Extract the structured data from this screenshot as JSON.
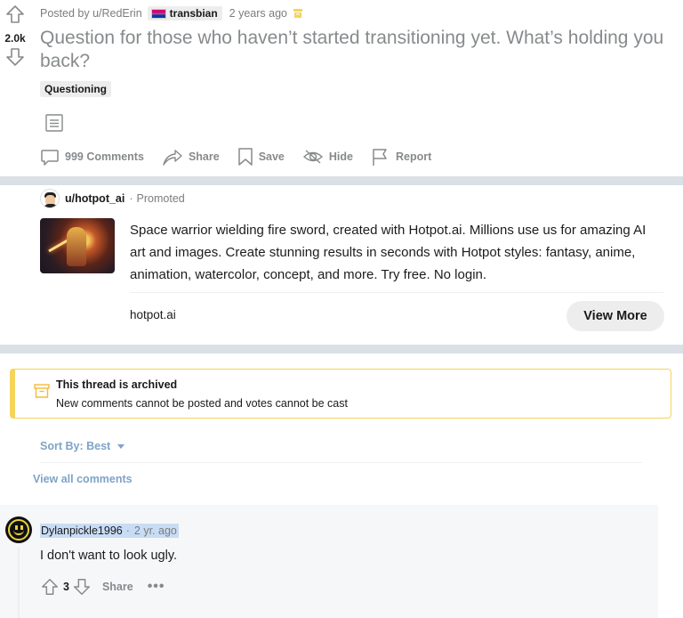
{
  "post": {
    "vote_score": "2.0k",
    "posted_by": "Posted by u/RedErin",
    "user_flair": "transbian",
    "time": "2 years ago",
    "title": "Question for those who haven’t started transitioning yet. What’s holding you back?",
    "flair": "Questioning",
    "actions": {
      "comments": "999 Comments",
      "share": "Share",
      "save": "Save",
      "hide": "Hide",
      "report": "Report"
    }
  },
  "promoted": {
    "user": "u/hotpot_ai",
    "separator": "·",
    "label": "Promoted",
    "text": "Space warrior wielding fire sword, created with Hotpot.ai. Millions use us for amazing AI art and images. Create stunning results in seconds with Hotpot styles: fantasy, anime, animation, watercolor, concept, and more. Try free. No login.",
    "domain": "hotpot.ai",
    "cta": "View More"
  },
  "archived": {
    "title": "This thread is archived",
    "subtitle": "New comments cannot be posted and votes cannot be cast"
  },
  "sort": {
    "label": "Sort By: Best"
  },
  "view_all": "View all comments",
  "comment": {
    "user": "Dylanpickle1996",
    "separator": "·",
    "time": "2 yr. ago",
    "body": "I don't want to look ugly.",
    "score": "3",
    "share": "Share",
    "more": "•••"
  },
  "colors": {
    "divider": "#dae0e6",
    "archived_border": "#f5d45a",
    "link": "#7ea3c7",
    "highlight": "#c8dcf5"
  }
}
